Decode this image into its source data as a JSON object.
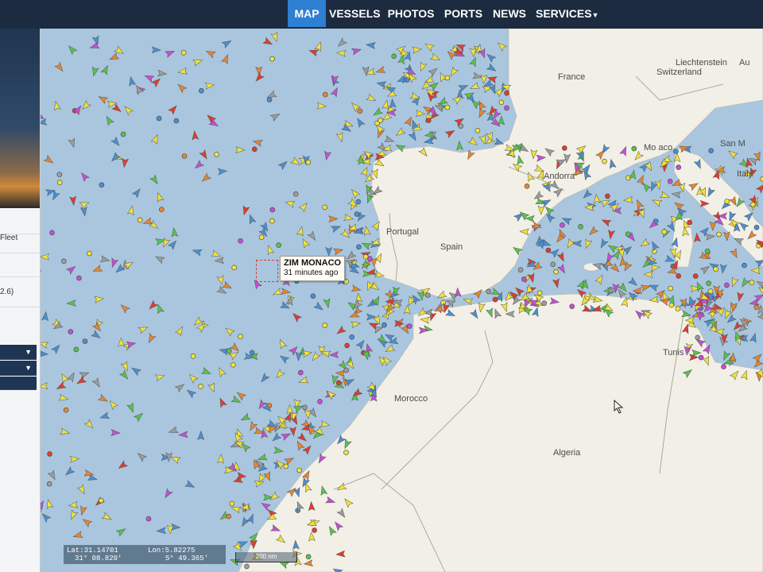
{
  "nav": {
    "items": [
      {
        "label": "MAP",
        "active": true
      },
      {
        "label": "VESSELS",
        "active": false
      },
      {
        "label": "PHOTOS",
        "active": false
      },
      {
        "label": "PORTS",
        "active": false
      },
      {
        "label": "NEWS",
        "active": false
      },
      {
        "label": "SERVICES",
        "active": false
      }
    ]
  },
  "left_panel": {
    "fleet_text": "Fleet",
    "value_text": "2.6)"
  },
  "tooltip": {
    "vessel_name": "ZIM MONACO",
    "last_seen": "31 minutes ago"
  },
  "countries": {
    "liechtenstein": "Liechtenstein",
    "austria_partial": "Au",
    "switzerland": "Switzerland",
    "france": "France",
    "monaco_partial": "Mo aco",
    "san_marino_partial": "San M",
    "andorra": "Andorra",
    "italy": "Italy",
    "portugal": "Portugal",
    "spain": "Spain",
    "tunisia_partial": "Tunis",
    "morocco": "Morocco",
    "algeria": "Algeria"
  },
  "readout": {
    "lat": "Lat:31.14701",
    "lon": "Lon:5.82275",
    "lat_dms": "31° 08.820'",
    "lon_dms": "5° 49.365'",
    "scale": "200 nm"
  },
  "colors": {
    "nav_bg": "#1c2b3f",
    "nav_active": "#2f7fd2",
    "sea": "#a9c6de",
    "land": "#f2efe6",
    "vessel_cargo": "#f2e33a",
    "vessel_tanker": "#e8852f",
    "vessel_passenger": "#4a8fd1",
    "vessel_pleasure": "#c44fd6",
    "vessel_fishing": "#9c9c9c",
    "vessel_tug": "#56c44a",
    "vessel_unknown": "#e23b2e"
  }
}
